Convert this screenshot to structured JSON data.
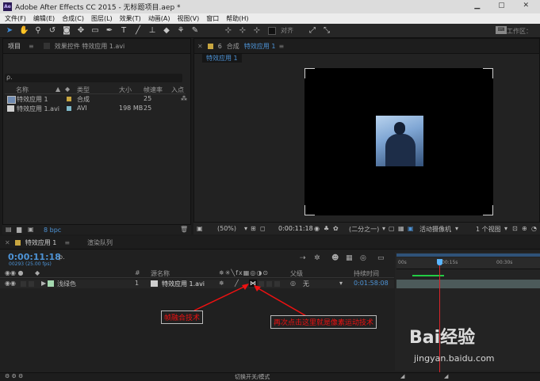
{
  "window": {
    "title": "Adobe After Effects CC 2015 - 无标题项目.aep *",
    "app_icon": "Ae"
  },
  "menu": [
    "文件(F)",
    "编辑(E)",
    "合成(C)",
    "图层(L)",
    "效果(T)",
    "动画(A)",
    "视图(V)",
    "窗口",
    "帮助(H)"
  ],
  "toolbar": {
    "align_label": "对齐",
    "workspace_label": "工作区：",
    "tools": [
      "selection-icon",
      "hand-icon",
      "zoom-icon",
      "rotate-icon",
      "camera-icon",
      "pan-behind-icon",
      "rectangle-icon",
      "pen-icon",
      "text-icon",
      "brush-icon",
      "clone-stamp-icon",
      "eraser-icon",
      "roto-brush-icon",
      "puppet-pin-icon"
    ]
  },
  "project": {
    "tab_label": "项目",
    "effects_tab": "效果控件 特效应用 1.avi",
    "search_glyph": "ρ.",
    "columns": {
      "name": "名称",
      "type": "类型",
      "size": "大小",
      "fps": "帧速率",
      "in": "入点"
    },
    "items": [
      {
        "name": "特效应用 1",
        "type": "合成",
        "size": "",
        "fps": "25",
        "color": "#c8a640"
      },
      {
        "name": "特效应用 1.avi",
        "type": "AVI",
        "size": "198 MB",
        "fps": "25",
        "color": "#7fb9c9"
      }
    ],
    "bpc": "8 bpc"
  },
  "comp": {
    "tab_prefix": "合成",
    "tab_name": "特效应用 1",
    "subtab": "特效应用 1",
    "zoom": "(50%)",
    "timecode": "0:00:11:18",
    "resolution": "(二分之一)",
    "camera": "活动摄像机",
    "views": "1 个视图"
  },
  "timeline": {
    "tab": "特效应用 1",
    "render_tab": "渲染队列",
    "timecode": "0:00:11:18",
    "fps_line": "00293 (25.00 fps)",
    "search_glyph": "ρ.",
    "columns": {
      "num": "#",
      "source": "源名称",
      "parent": "父级",
      "duration": "持续时间"
    },
    "ruler": [
      "00s",
      "00:15s",
      "00:30s"
    ],
    "layer_label": "浅绿色",
    "layer": {
      "num": "1",
      "name": "特效应用 1.avi",
      "parent": "无",
      "duration": "0:01:58:08"
    },
    "footer": "切换开关/模式"
  },
  "annotations": {
    "motion_blur_tip": "帧融合技术",
    "pixel_motion_tip": "再次点击这里就是像素运动技术"
  },
  "watermark": {
    "text": "Bai经验",
    "url": "jingyan.baidu.com"
  }
}
